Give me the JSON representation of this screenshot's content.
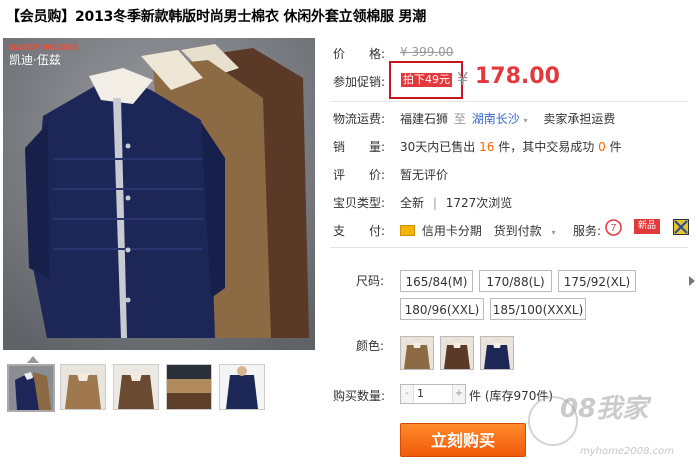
{
  "title": "【会员购】2013冬季新款韩版时尚男士棉衣 休闲外套立领棉服 男潮",
  "brand": {
    "line1": "DANDY WOODS",
    "line2": "凯迪·伍兹"
  },
  "price": {
    "label": "价　　格:",
    "original": "¥ 399.00"
  },
  "promo": {
    "label": "参加促销:",
    "tag": "拍下49元",
    "yen": "¥",
    "price": "178.00"
  },
  "shipping": {
    "label": "物流运费:",
    "from": "福建石狮",
    "sep": "至",
    "to": "湖南长沙",
    "fee": "卖家承担运费"
  },
  "sales": {
    "label": "销　　量:",
    "prefix": "30天内已售出",
    "sold": "16",
    "mid": "件，其中交易成功",
    "success": "0",
    "suffix": "件"
  },
  "reviews": {
    "label": "评　　价:",
    "value": "暂无评价"
  },
  "item_type": {
    "label": "宝贝类型:",
    "condition": "全新",
    "sep": "|",
    "views": "1727次浏览"
  },
  "payment": {
    "label": "支　　付:",
    "credit": "信用卡分期",
    "cod": "货到付款",
    "service_label": "服务:",
    "new_badge": "新品"
  },
  "size": {
    "label": "尺码:",
    "options": [
      "165/84(M)",
      "170/88(L)",
      "175/92(XL)",
      "180/96(XXL)",
      "185/100(XXXL)"
    ]
  },
  "color": {
    "label": "颜色:",
    "options": [
      "navy",
      "tan",
      "brown"
    ]
  },
  "quantity": {
    "label": "购买数量:",
    "minus": "-",
    "value": "1",
    "plus": "+",
    "unit": "件",
    "stock": "(库存970件)"
  },
  "buy_button": "立刻购买",
  "watermark": {
    "main": "08我家",
    "url": "myhome2008.com"
  },
  "colors": {
    "accent": "#e4393c",
    "orange": "#ff6600",
    "link": "#3366cc",
    "buy": "#f05a0c"
  }
}
